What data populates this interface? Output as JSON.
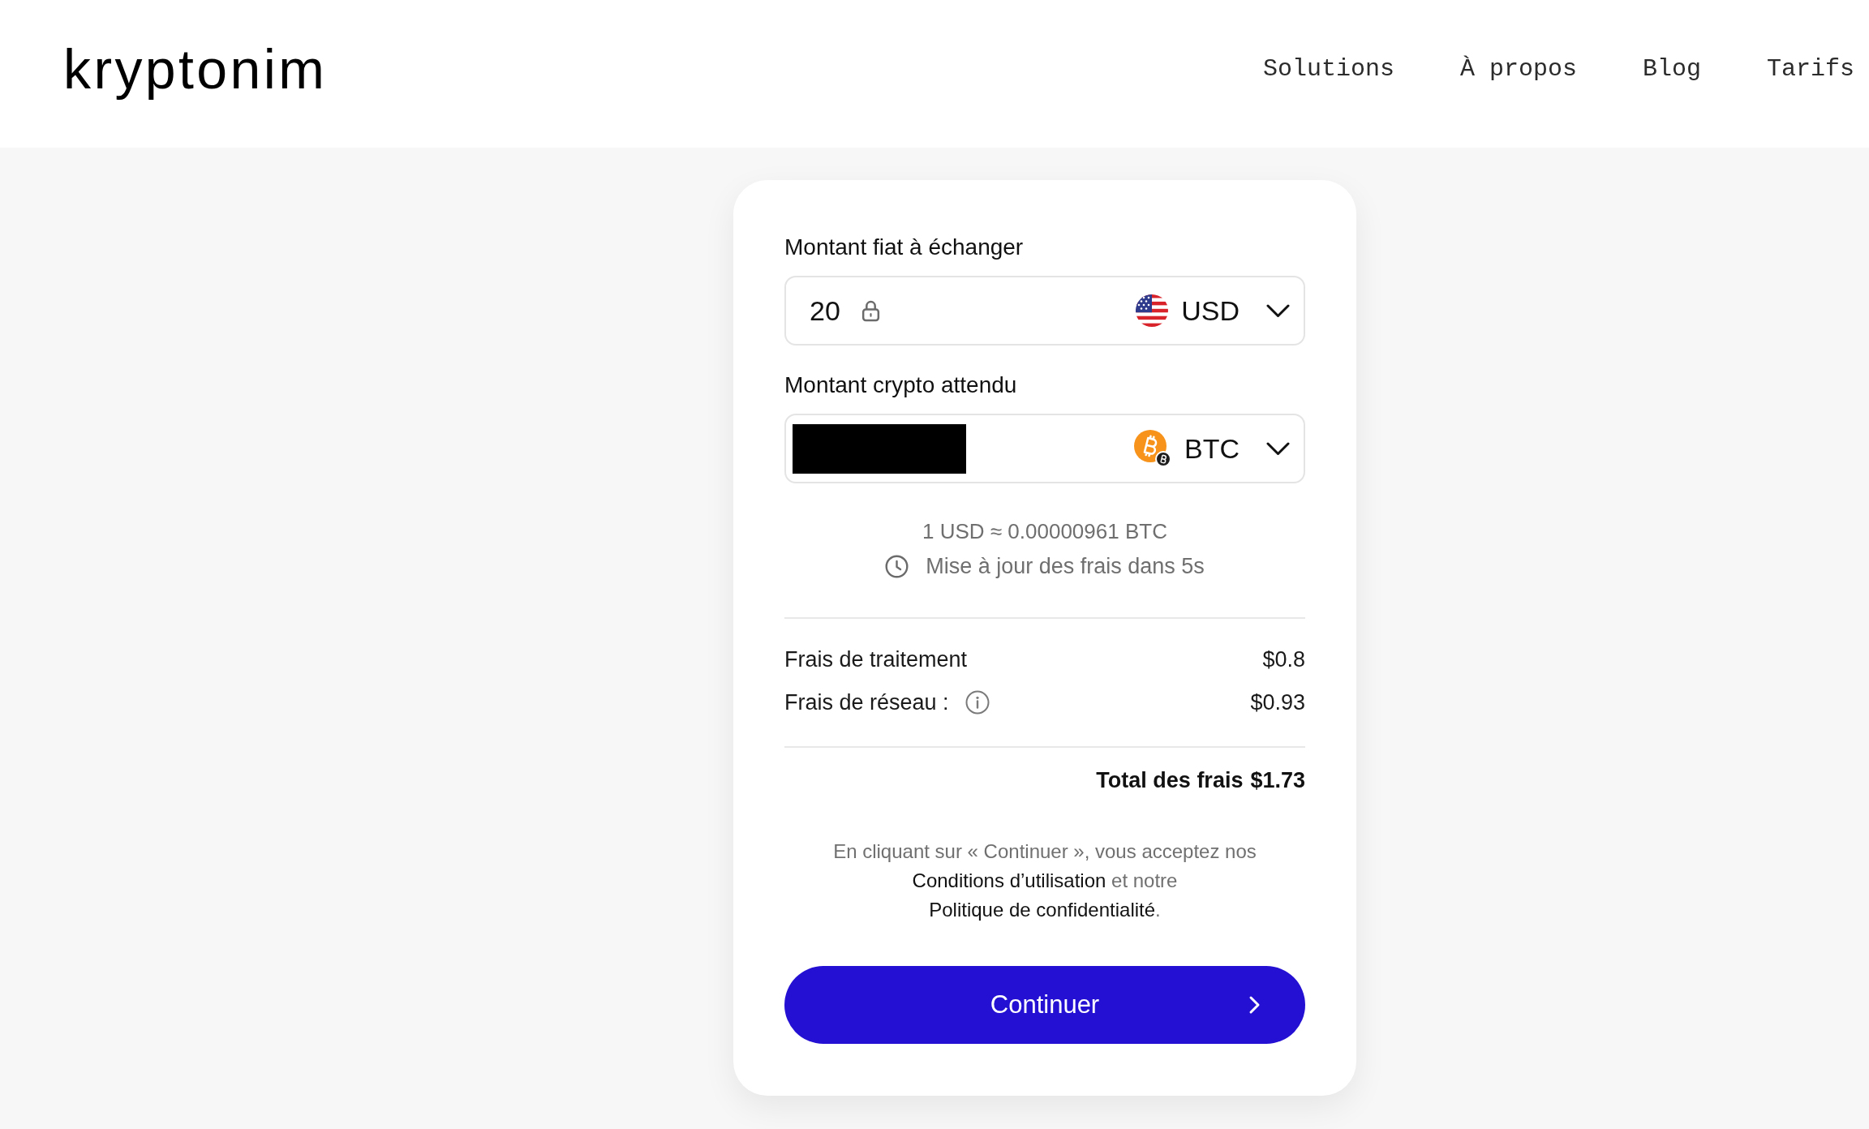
{
  "header": {
    "logo": "kryptonim",
    "nav": [
      {
        "label": "Solutions"
      },
      {
        "label": "À propos"
      },
      {
        "label": "Blog"
      },
      {
        "label": "Tarifs"
      }
    ]
  },
  "form": {
    "fields": [
      {
        "label": "Montant fiat à échanger",
        "kind": "fiat",
        "value": "20",
        "locked": true,
        "redacted": false,
        "currency": "USD"
      },
      {
        "label": "Montant crypto attendu",
        "kind": "crypto",
        "locked": false,
        "redacted": true,
        "currency": "BTC"
      }
    ],
    "rate": "1 USD ≈ 0.00000961 BTC",
    "refresh_note": "Mise à jour des frais dans 5s",
    "fees": [
      {
        "label": "Frais de traitement",
        "info": false,
        "amount": "$0.8"
      },
      {
        "label": "Frais de réseau :",
        "info": true,
        "amount": "$0.93"
      }
    ],
    "total": {
      "label": "Total des frais",
      "amount": "$1.73"
    },
    "terms": [
      {
        "kind": "text",
        "text": "En cliquant sur « Continuer », vous acceptez nos"
      },
      {
        "kind": "link",
        "text": "Conditions d’utilisation"
      },
      {
        "kind": "text",
        "text": "et notre"
      },
      {
        "kind": "link",
        "text": "Politique de confidentialité"
      },
      {
        "kind": "punct",
        "text": "."
      }
    ],
    "submit": "Continuer"
  }
}
